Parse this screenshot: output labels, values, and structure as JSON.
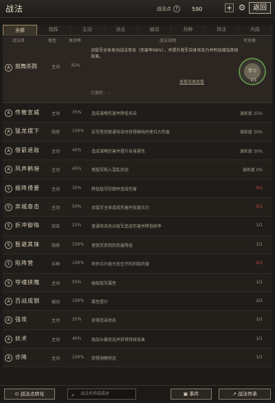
{
  "header": {
    "title": "战法",
    "points_label": "战法点",
    "points_value": "590",
    "plus_label": "+",
    "back_label": "返回"
  },
  "tabs": [
    "全部",
    "指挥",
    "主动",
    "突击",
    "被动",
    "兵种",
    "阵法",
    "内政"
  ],
  "columns": {
    "name": "战法名",
    "type": "类型",
    "rate": "发动率",
    "desc": "战法说明",
    "status": "可兑换"
  },
  "expanded": {
    "name": "鼓舞杀戮",
    "type": "主动",
    "rate": "35%",
    "desc": "对敌军全体发动战法攻击（伤害率98%），并提升我军自身攻击力并附加增加其他效果。",
    "detail_link": "查看效果查看",
    "owned_label": "已拥有：--",
    "learn_label": "学习",
    "count": "1/1"
  },
  "rows": [
    {
      "badge": "A",
      "name": "传檄宣威",
      "type": "主动",
      "rate": "35%",
      "desc": "造成谋略伤害并降低攻击",
      "status": "演练度 35%",
      "status_red": false
    },
    {
      "badge": "A",
      "name": "猛龙摆下",
      "type": "指挥",
      "rate": "100%",
      "desc": "友军受到普通攻击时获得格挡并使兵力伤害",
      "status": "演练度 30%",
      "status_red": false
    },
    {
      "badge": "A",
      "name": "借箭退敌",
      "type": "主动",
      "rate": "40%",
      "desc": "造成谋略伤害并提升自身属性",
      "status": "演练度 30%",
      "status_red": false
    },
    {
      "badge": "A",
      "name": "风声鹤唳",
      "type": "主动",
      "rate": "45%",
      "desc": "使敌军陷入混乱状态",
      "status": "演练度 0%",
      "status_red": false
    },
    {
      "badge": "S",
      "name": "掘阵侵要",
      "type": "主动",
      "rate": "35%",
      "desc": "降低敌军防御并造成伤害",
      "status": "0/1",
      "status_red": true
    },
    {
      "badge": "S",
      "name": "奔城奋击",
      "type": "主动",
      "rate": "50%",
      "desc": "对敌军全体造成伤害并恢复兵力",
      "status": "0/1",
      "status_red": true
    },
    {
      "badge": "S",
      "name": "折冲御侮",
      "type": "突击",
      "rate": "25%",
      "desc": "普通攻击后对敌军造成伤害并降低统率",
      "status": "1/1",
      "status_red": false
    },
    {
      "badge": "S",
      "name": "暂避其锋",
      "type": "指挥",
      "rate": "100%",
      "desc": "使我军受到的伤害降低",
      "status": "1/1",
      "status_red": false
    },
    {
      "badge": "S",
      "name": "陷阵营",
      "type": "兵种",
      "rate": "100%",
      "desc": "将步兵升级为无往不利的陷阵营",
      "status": "0/1",
      "status_red": true
    },
    {
      "badge": "S",
      "name": "夺魂挟魄",
      "type": "主动",
      "rate": "55%",
      "desc": "偷取敌军属性",
      "status": "1/1",
      "status_red": false
    },
    {
      "badge": "A",
      "name": "百战成钢",
      "type": "被动",
      "rate": "100%",
      "desc": "属性提升",
      "status": "2/2",
      "status_red": false
    },
    {
      "badge": "A",
      "name": "强攻",
      "type": "主动",
      "rate": "25%",
      "desc": "获得连击状态",
      "status": "1/1",
      "status_red": false
    },
    {
      "badge": "A",
      "name": "妖术",
      "type": "主动",
      "rate": "40%",
      "desc": "施加沙暴状态并获得持续效果",
      "status": "1/1",
      "status_red": false
    },
    {
      "badge": "A",
      "name": "诈降",
      "type": "主动",
      "rate": "100%",
      "desc": "获得洞察状态",
      "status": "1/1",
      "status_red": false
    }
  ],
  "bottom": {
    "convert_label": "战法点转化",
    "search_placeholder": "战法名称或描述",
    "event_label": "事件",
    "inherit_label": "战法传承"
  }
}
